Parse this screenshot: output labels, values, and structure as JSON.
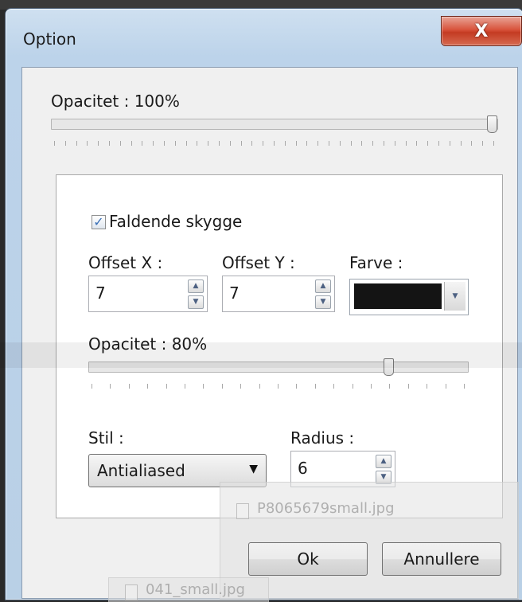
{
  "window": {
    "title": "Option",
    "close_glyph": "X",
    "close_icon": "close-icon"
  },
  "opacity": {
    "label": "Opacitet : 100%",
    "value_percent": 100
  },
  "shadow": {
    "checkbox_label": "Faldende skygge",
    "checked": true,
    "offset_x": {
      "label": "Offset X :",
      "value": "7"
    },
    "offset_y": {
      "label": "Offset Y :",
      "value": "7"
    },
    "color": {
      "label": "Farve :",
      "value": "#141414"
    },
    "opacity": {
      "label": "Opacitet : 80%",
      "value_percent": 80
    },
    "style": {
      "label": "Stil :",
      "value": "Antialiased"
    },
    "radius": {
      "label": "Radius :",
      "value": "6"
    }
  },
  "background_items": [
    {
      "name": "P8065679small.jpg"
    },
    {
      "name": "041_small.jpg"
    }
  ],
  "buttons": {
    "ok": "Ok",
    "cancel": "Annullere"
  }
}
